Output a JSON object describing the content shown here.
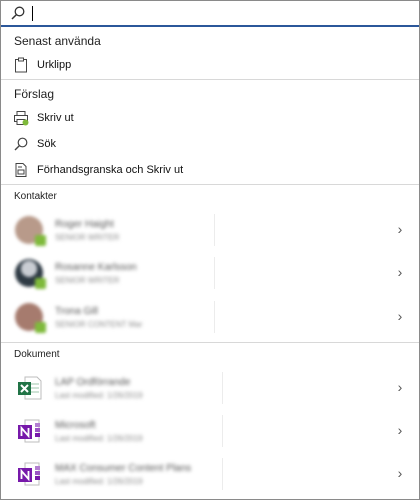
{
  "search": {
    "value": "",
    "placeholder": ""
  },
  "recent": {
    "title": "Senast använda",
    "items": [
      {
        "label": "Urklipp",
        "icon": "clipboard-icon"
      }
    ]
  },
  "suggestions": {
    "title": "Förslag",
    "items": [
      {
        "label": "Skriv ut",
        "icon": "printer-icon"
      },
      {
        "label": "Sök",
        "icon": "search-icon"
      },
      {
        "label": "Förhandsgranska och Skriv ut",
        "icon": "print-preview-icon"
      }
    ]
  },
  "contacts": {
    "title": "Kontakter",
    "items": [
      {
        "name": "Roger Haight",
        "detail": "SENIOR WRITER",
        "avatar_color": "#b89a8a"
      },
      {
        "name": "Rosanne Karlsson",
        "detail": "SENIOR WRITER",
        "avatar_color": "#2e3a44"
      },
      {
        "name": "Trona Gill",
        "detail": "SENIOR CONTENT Mar",
        "avatar_color": "#a67b6e"
      }
    ]
  },
  "documents": {
    "title": "Dokument",
    "items": [
      {
        "name": "LAP Ordförrande",
        "detail": "Last modified: 1/26/2019",
        "icon": "excel-file-icon"
      },
      {
        "name": "Microsoft",
        "detail": "Last modified: 1/26/2019",
        "icon": "onenote-file-icon"
      },
      {
        "name": "MAX Consumer Content Plans",
        "detail": "Last modified: 1/26/2019",
        "icon": "onenote-file-icon"
      }
    ]
  },
  "colors": {
    "accent": "#2b579a",
    "presence": "#7fba3b",
    "excel": "#217346",
    "onenote": "#7719aa"
  }
}
